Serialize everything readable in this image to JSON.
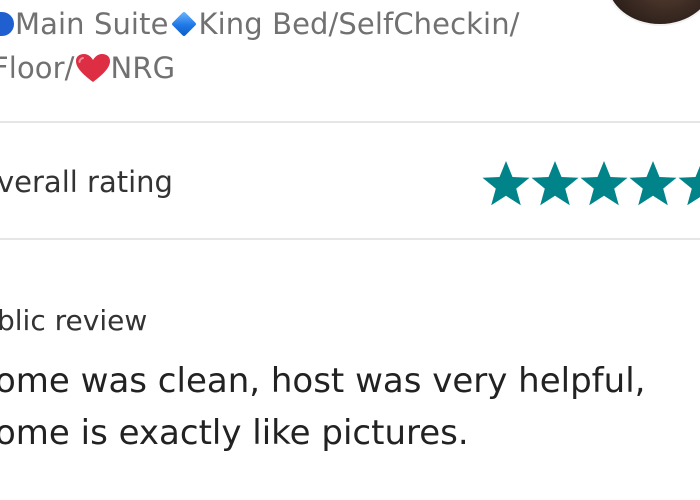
{
  "listing": {
    "title_line1_a": "Main Suite",
    "title_line1_b": "King Bed/SelfCheckin/",
    "title_line2_a": "Floor/",
    "title_line2_b": "NRG",
    "emoji": [
      "blue-circle-icon",
      "blue-diamond-icon",
      "red-heart-icon"
    ]
  },
  "rating": {
    "label": "verall rating",
    "stars_shown": 5,
    "star_color": "#008489"
  },
  "review": {
    "heading": "blic review",
    "body_line1": "ome was clean, host was very helpful,",
    "body_line2": "ome is exactly like pictures."
  },
  "colors": {
    "muted_text": "#717171",
    "body_text": "#222222",
    "divider": "#e6e6e6",
    "heart": "#dd2e44",
    "diamond": "#1e78e6"
  }
}
